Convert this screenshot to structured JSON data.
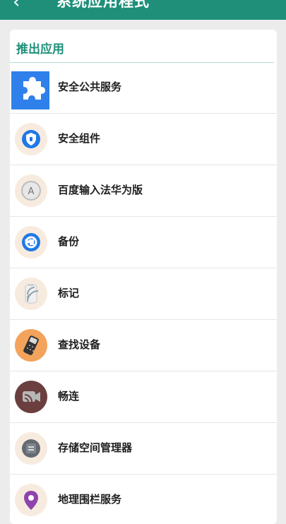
{
  "header": {
    "title": "系统应用程式",
    "back_icon": "back-arrow-icon"
  },
  "section": {
    "title": "推出应用"
  },
  "apps": [
    {
      "label": "安全公共服务",
      "icon": "puzzle-icon"
    },
    {
      "label": "安全组件",
      "icon": "shield-icon"
    },
    {
      "label": "百度输入法华为版",
      "icon": "keyboard-a-icon"
    },
    {
      "label": "备份",
      "icon": "backup-icon"
    },
    {
      "label": "标记",
      "icon": "nfc-tag-icon"
    },
    {
      "label": "查找设备",
      "icon": "find-device-icon"
    },
    {
      "label": "畅连",
      "icon": "video-call-icon"
    },
    {
      "label": "存储空间管理器",
      "icon": "storage-manager-icon"
    },
    {
      "label": "地理围栏服务",
      "icon": "location-pin-icon"
    }
  ]
}
